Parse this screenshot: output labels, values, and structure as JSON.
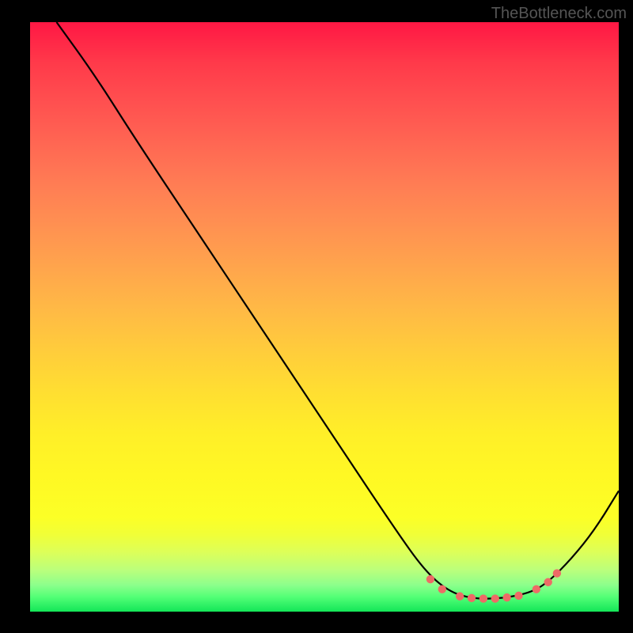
{
  "watermark": "TheBottleneck.com",
  "chart_data": {
    "type": "line",
    "title": "",
    "xlabel": "",
    "ylabel": "",
    "xlim": [
      0,
      100
    ],
    "ylim": [
      0,
      100
    ],
    "series": [
      {
        "name": "curve",
        "points": [
          {
            "x": 4.5,
            "y": 100
          },
          {
            "x": 11,
            "y": 91
          },
          {
            "x": 18,
            "y": 80
          },
          {
            "x": 28,
            "y": 65
          },
          {
            "x": 40,
            "y": 47
          },
          {
            "x": 52,
            "y": 29
          },
          {
            "x": 62,
            "y": 14
          },
          {
            "x": 67,
            "y": 7
          },
          {
            "x": 71,
            "y": 3.5
          },
          {
            "x": 75,
            "y": 2.2
          },
          {
            "x": 80,
            "y": 2.2
          },
          {
            "x": 85,
            "y": 3.2
          },
          {
            "x": 88,
            "y": 5
          },
          {
            "x": 92,
            "y": 9
          },
          {
            "x": 96,
            "y": 14
          },
          {
            "x": 100,
            "y": 20.5
          }
        ]
      }
    ],
    "markers": [
      {
        "x": 68,
        "y": 5.5
      },
      {
        "x": 70,
        "y": 3.8
      },
      {
        "x": 73,
        "y": 2.6
      },
      {
        "x": 75,
        "y": 2.3
      },
      {
        "x": 77,
        "y": 2.2
      },
      {
        "x": 79,
        "y": 2.2
      },
      {
        "x": 81,
        "y": 2.4
      },
      {
        "x": 83,
        "y": 2.7
      },
      {
        "x": 86,
        "y": 3.8
      },
      {
        "x": 88,
        "y": 5.0
      },
      {
        "x": 89.5,
        "y": 6.5
      }
    ],
    "gradient_description": "vertical red-to-green heatmap background"
  }
}
